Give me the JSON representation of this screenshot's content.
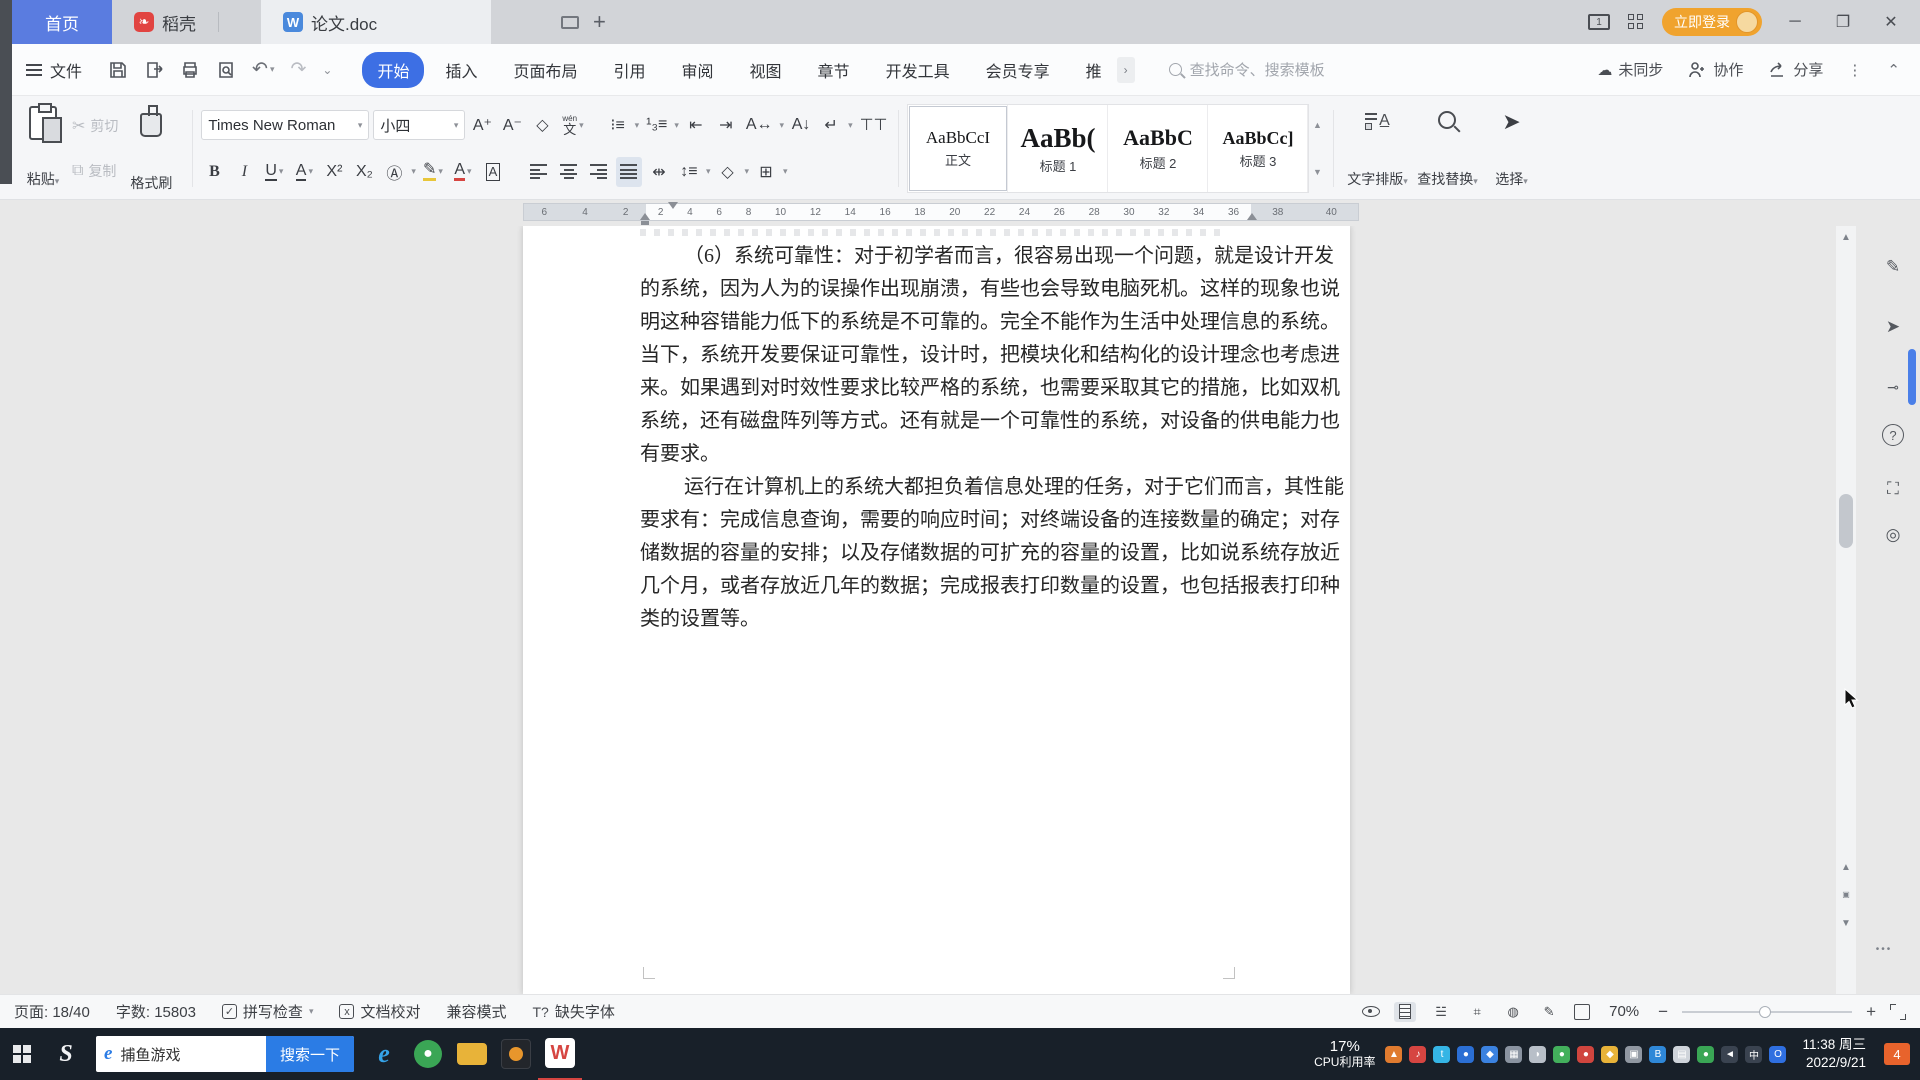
{
  "colors": {
    "accent": "#3d6fe4",
    "home_tab": "#5a7ce0",
    "login": "#f0a32e",
    "daoke": "#e14441",
    "taskbar": "#182029",
    "search_button": "#2b7ce5"
  },
  "tabbar": {
    "home_tab": "首页",
    "daoke_tab": "稻壳",
    "doc_tab": "论文.doc",
    "login": "立即登录"
  },
  "menubar": {
    "file": "文件",
    "items": [
      {
        "label": "开始",
        "active": true
      },
      {
        "label": "插入",
        "active": false
      },
      {
        "label": "页面布局",
        "active": false
      },
      {
        "label": "引用",
        "active": false
      },
      {
        "label": "审阅",
        "active": false
      },
      {
        "label": "视图",
        "active": false
      },
      {
        "label": "章节",
        "active": false
      },
      {
        "label": "开发工具",
        "active": false
      },
      {
        "label": "会员专享",
        "active": false
      },
      {
        "label": "推",
        "active": false
      }
    ],
    "search_placeholder": "查找命令、搜索模板",
    "sync": "未同步",
    "collab": "协作",
    "share": "分享"
  },
  "ribbon": {
    "paste": "粘贴",
    "cut": "剪切",
    "copy": "复制",
    "format_painter": "格式刷",
    "font_name": "Times New Roman",
    "font_size": "小四",
    "glyphs": {
      "grow": "A⁺",
      "shrink": "A⁻",
      "clear": "◇",
      "pinyin_top": "wén",
      "pinyin": "文",
      "bold": "B",
      "italic": "I",
      "underline": "U",
      "strike": "A",
      "sup": "X²",
      "sub": "X₂",
      "shade": "Ⓐ",
      "highlight": "✎",
      "fontcolor": "A",
      "charborder": "A",
      "dec_indent": "⇤",
      "inc_indent": "⇥",
      "scale": "A↔",
      "sort": "A↓",
      "wrap": "↵",
      "bullets": "⁝≡",
      "numbering": "¹₃≡",
      "tabs": "⊤⊤",
      "spacing": "↕≡",
      "shading": "◇",
      "borders": "⊞"
    },
    "styles": [
      {
        "preview": "AaBbCcI",
        "label": "正文",
        "size": 17,
        "bold": false,
        "selected": true
      },
      {
        "preview": "AaBb(",
        "label": "标题 1",
        "size": 27,
        "bold": true,
        "selected": false
      },
      {
        "preview": "AaBbC",
        "label": "标题 2",
        "size": 22,
        "bold": true,
        "selected": false
      },
      {
        "preview": "AaBbCc]",
        "label": "标题 3",
        "size": 18,
        "bold": true,
        "selected": false
      }
    ],
    "text_layout": "文字排版",
    "find_replace": "查找替换",
    "select": "选择"
  },
  "ruler": {
    "left_numbers": [
      "6",
      "4",
      "2"
    ],
    "numbers": [
      "2",
      "4",
      "6",
      "8",
      "10",
      "12",
      "14",
      "16",
      "18",
      "20",
      "22",
      "24",
      "26",
      "28",
      "30",
      "32",
      "34",
      "36"
    ],
    "right_numbers": [
      "38",
      "40"
    ]
  },
  "document": {
    "paragraphs": [
      {
        "lines": [
          "（6）系统可靠性：对于初学者而言，很容易出现一个问题，就是设计开发",
          "的系统，因为人为的误操作出现崩溃，有些也会导致电脑死机。这样的现象也说",
          "明这种容错能力低下的系统是不可靠的。完全不能作为生活中处理信息的系统。",
          "当下，系统开发要保证可靠性，设计时，把模块化和结构化的设计理念也考虑进",
          "来。如果遇到对时效性要求比较严格的系统，也需要采取其它的措施，比如双机",
          "系统，还有磁盘阵列等方式。还有就是一个可靠性的系统，对设备的供电能力也",
          "有要求。"
        ]
      },
      {
        "lines": [
          "运行在计算机上的系统大都担负着信息处理的任务，对于它们而言，其性能",
          "要求有：完成信息查询，需要的响应时间；对终端设备的连接数量的确定；对存",
          "储数据的容量的安排；以及存储数据的可扩充的容量的设置，比如说系统存放近",
          "几个月，或者存放近几年的数据；完成报表打印数量的设置，也包括报表打印种",
          "类的设置等。"
        ]
      }
    ]
  },
  "statusbar": {
    "page": "页面: 18/40",
    "words": "字数: 15803",
    "spellcheck": "拼写检查",
    "proofread": "文档校对",
    "compat": "兼容模式",
    "missing_font": "缺失字体",
    "missing_font_glyph": "T?",
    "zoom": "70%"
  },
  "taskbar": {
    "search_query": "捕鱼游戏",
    "search_button": "搜索一下",
    "cpu_percent": "17%",
    "cpu_label": "CPU利用率",
    "time_line": "11:38 周三",
    "date": "2022/9/21",
    "badge": "4",
    "tray": [
      {
        "name": "hardware-monitor-icon",
        "color": "#e07b2f",
        "glyph": "▲"
      },
      {
        "name": "music-app-icon",
        "color": "#d64541",
        "glyph": "♪"
      },
      {
        "name": "tim-icon",
        "color": "#35b5e5",
        "glyph": "t"
      },
      {
        "name": "qq-icon",
        "color": "#2b6fd4",
        "glyph": "●"
      },
      {
        "name": "security-shield-icon",
        "color": "#3b82e0",
        "glyph": "◆"
      },
      {
        "name": "network-icon",
        "color": "#8a93a0",
        "glyph": "▦"
      },
      {
        "name": "notification-bell-icon",
        "color": "#b8bfc8",
        "glyph": "◗"
      },
      {
        "name": "battery-saver-icon",
        "color": "#43b05c",
        "glyph": "●"
      },
      {
        "name": "download-app-icon",
        "color": "#d0453e",
        "glyph": "●"
      },
      {
        "name": "key-manager-icon",
        "color": "#e8b339",
        "glyph": "◆"
      },
      {
        "name": "driver-app-icon",
        "color": "#9097a1",
        "glyph": "▣"
      },
      {
        "name": "bluetooth-icon",
        "color": "#2f88d8",
        "glyph": "B"
      },
      {
        "name": "clipboard-tray-icon",
        "color": "#cfd4da",
        "glyph": "▤"
      },
      {
        "name": "green-app-icon",
        "color": "#3aa655",
        "glyph": "●"
      },
      {
        "name": "volume-icon",
        "color": "#3a4350",
        "glyph": "◄"
      },
      {
        "name": "ime-icon",
        "color": "#3a4350",
        "glyph": "中"
      },
      {
        "name": "opera-icon",
        "color": "#2f6fe0",
        "glyph": "O"
      }
    ]
  }
}
